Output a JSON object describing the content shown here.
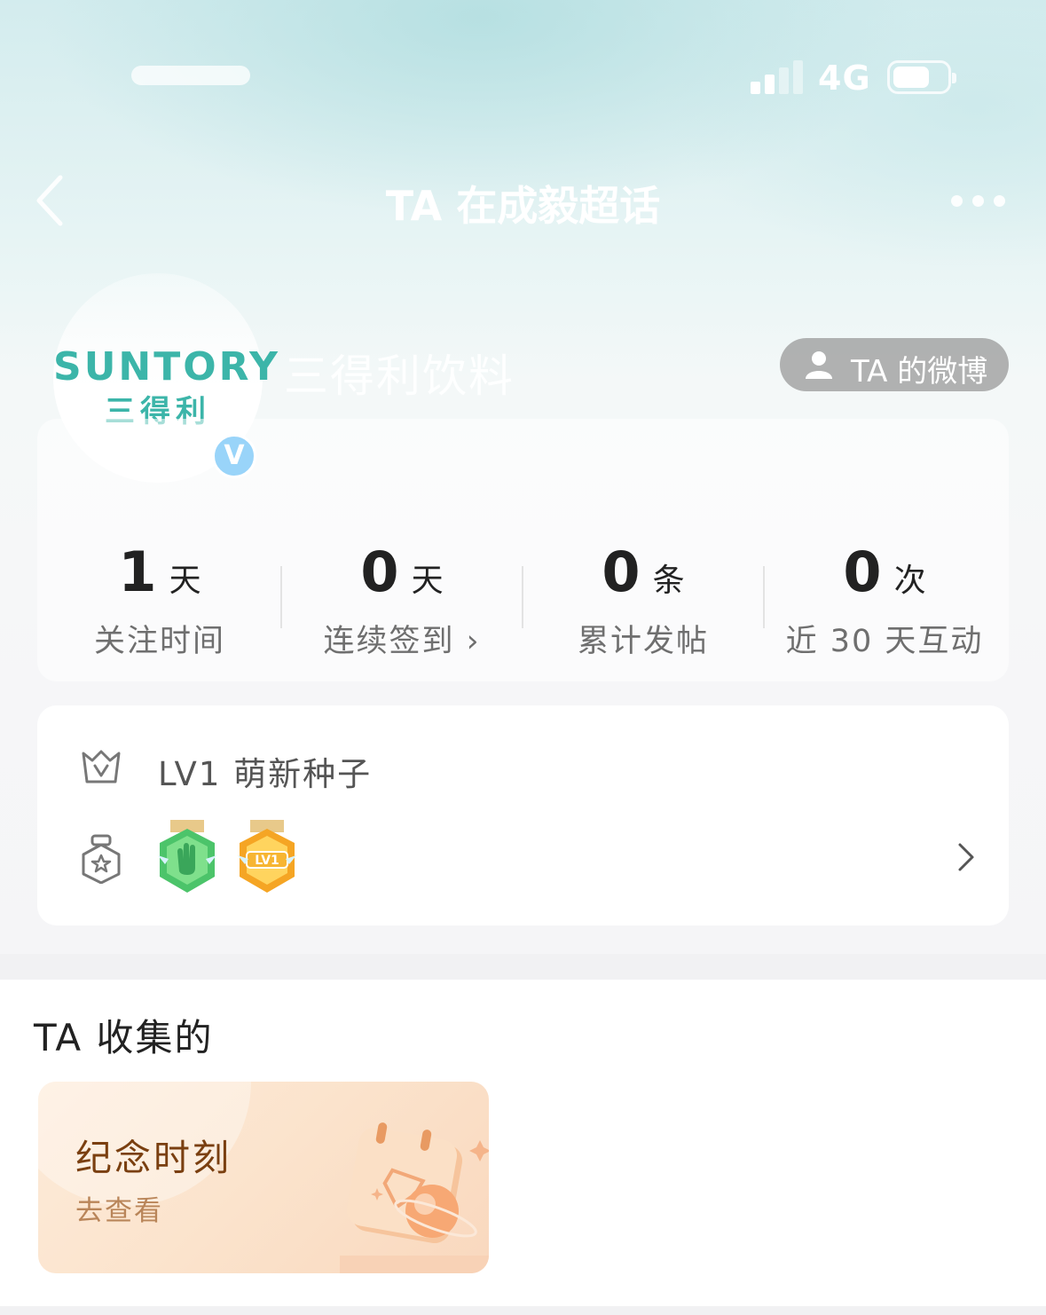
{
  "status_bar": {
    "network": "4G"
  },
  "nav": {
    "title": "TA 在成毅超话"
  },
  "profile": {
    "logo_en": "SUNTORY",
    "logo_cn": "三得利",
    "verified_mark": "V",
    "username": "三得利饮料",
    "weibo_button_label": "TA 的微博"
  },
  "stats": [
    {
      "value": "1",
      "unit": "天",
      "label": "关注时间"
    },
    {
      "value": "0",
      "unit": "天",
      "label": "连续签到 ›"
    },
    {
      "value": "0",
      "unit": "条",
      "label": "累计发帖"
    },
    {
      "value": "0",
      "unit": "次",
      "label": "近 30 天互动"
    }
  ],
  "level": {
    "text": "LV1 萌新种子"
  },
  "medals": [
    {
      "icon": "waving-hand-medal-icon",
      "color": "#4cc46a"
    },
    {
      "icon": "lv1-medal-icon",
      "label": "LV1",
      "color": "#f5a524"
    }
  ],
  "collection": {
    "title": "TA 收集的",
    "card": {
      "title": "纪念时刻",
      "action": "去查看"
    }
  },
  "colors": {
    "brand_teal": "#3cb5a9",
    "verify_blue": "#1da1f2",
    "memorial_brown": "#7a3f10"
  }
}
